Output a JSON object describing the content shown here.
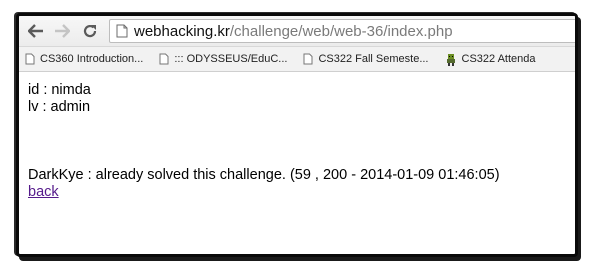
{
  "browser": {
    "url_host": "webhacking.kr",
    "url_path": "/challenge/web/web-36/index.php",
    "bookmarks": [
      {
        "label": "CS360 Introduction..."
      },
      {
        "label": "::: ODYSSEUS/EduC..."
      },
      {
        "label": "CS322 Fall Semeste..."
      },
      {
        "label": "CS322 Attenda"
      }
    ]
  },
  "page": {
    "id_line": "id : nimda",
    "lv_line": "lv : admin",
    "solved_line": "DarkKye : already solved this challenge. (59 , 200 - 2014-01-09 01:46:05)",
    "back_link": "back"
  },
  "icons": {
    "back": "arrow-left-icon",
    "forward": "arrow-right-icon",
    "reload": "reload-icon",
    "page": "page-icon",
    "bookmark_page": "page-icon",
    "bookmark_game": "game-character-icon"
  }
}
